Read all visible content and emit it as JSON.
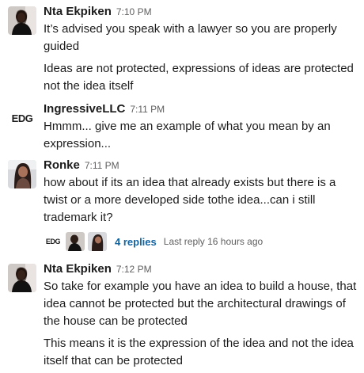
{
  "messages": [
    {
      "author": "Nta Ekpiken",
      "time": "7:10 PM",
      "paragraphs": [
        "It’s advised you speak with a lawyer so you are properly guided",
        "Ideas are not protected, expressions of ideas are protected not the idea itself"
      ]
    },
    {
      "author": "IngressiveLLC",
      "avatar_text": "EDG",
      "time": "7:11 PM",
      "paragraphs": [
        "Hmmm... give me an example of what you mean by an expression..."
      ]
    },
    {
      "author": "Ronke",
      "time": "7:11 PM",
      "paragraphs": [
        "how about if its an idea that already exists but there is a twist or a more developed side tothe idea...can i still trademark it?"
      ]
    },
    {
      "author": "Nta Ekpiken",
      "time": "7:12 PM",
      "paragraphs": [
        "So take for example you have an idea to build a house, that idea cannot be protected but the architectural drawings of the house can be protected",
        "This means it is the expression of the idea and not the idea itself that can be protected"
      ]
    }
  ],
  "thread": {
    "participant_logo_text": "EDG",
    "replies_label": "4 replies",
    "last_reply": "Last reply 16 hours ago"
  },
  "colors": {
    "link": "#1264a3",
    "muted": "#616061",
    "text": "#1d1c1d"
  }
}
